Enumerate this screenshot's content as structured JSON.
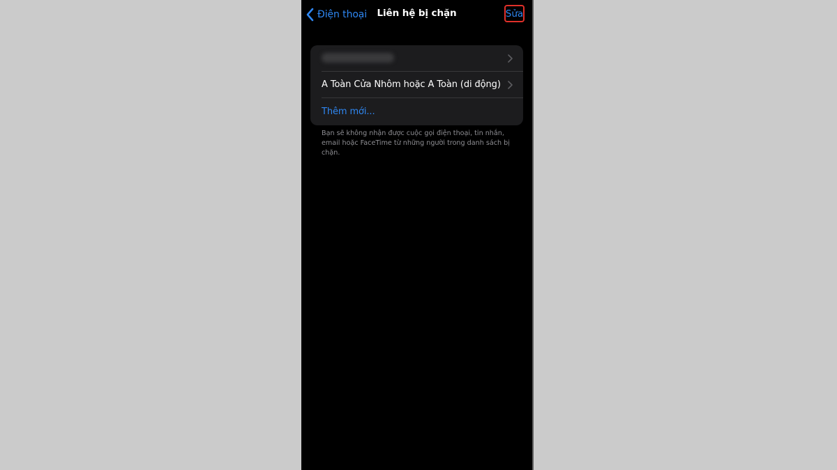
{
  "nav": {
    "back_label": "Điện thoại",
    "title": "Liên hệ bị chặn",
    "edit_label": "Sửa"
  },
  "blocked_list": {
    "items": [
      {
        "label": "",
        "redacted": true
      },
      {
        "label": "A Toàn Cửa Nhôm hoặc A Toàn (di động)"
      }
    ],
    "add_new_label": "Thêm mới..."
  },
  "footer": {
    "note": "Bạn sẽ không nhận được cuộc gọi điện thoại, tin nhắn, email hoặc FaceTime từ những người trong danh sách bị chặn."
  },
  "colors": {
    "background": "#000000",
    "accent": "#2f87f2",
    "group_bg": "#1c1c1e",
    "highlight_border": "#e0302a"
  }
}
